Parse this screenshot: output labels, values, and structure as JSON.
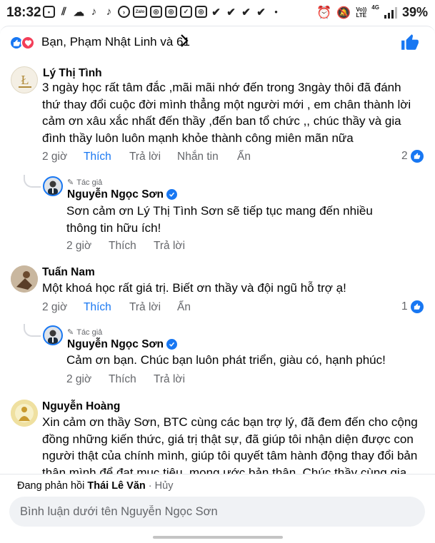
{
  "status_bar": {
    "time": "18:32",
    "left_icons": [
      "gallery-icon",
      "signal-bars-icon",
      "cloud-icon",
      "tiktok-icon",
      "tiktok-icon",
      "play-icon",
      "zalo-icon",
      "instagram-icon",
      "instagram-icon",
      "check-icon",
      "instagram-icon",
      "check-icon",
      "check-icon",
      "check-icon",
      "check-icon",
      "dot-icon"
    ],
    "zalo_label": "Zalo",
    "net_top": "Vo))",
    "net_bottom": "LTE",
    "net_gen": "4G",
    "battery": "39%"
  },
  "reactions": {
    "text": "Bạn, Phạm Nhật Linh và 61"
  },
  "comments": [
    {
      "author": "Lý Thị Tình",
      "text": "3 ngày  học rất tâm đắc  ,mãi mãi nhớ đến  trong 3ngày thôi đã đánh thứ thay đổi cuộc đời mình thẳng một người mới ,   em chân thành lời cảm ơn xâu xắc nhất đến thầy ,đến ban tổ chức ,, chúc thầy và gia đình thầy luôn luôn mạnh khỏe  thành công miên mãn  nữa",
      "time": "2 giờ",
      "like": "Thích",
      "reply": "Trả lời",
      "message": "Nhắn tin",
      "hide": "Ẩn",
      "reaction_count": "2"
    },
    {
      "author": "Tuấn Nam",
      "text": "Một khoá học rất giá trị. Biết ơn thầy và đội ngũ hỗ trợ ạ!",
      "time": "2 giờ",
      "like": "Thích",
      "reply": "Trả lời",
      "hide": "Ẩn",
      "reaction_count": "1"
    },
    {
      "author": "Nguyễn Hoàng",
      "text": "Xin cảm ơn thầy Sơn, BTC cùng các bạn trợ lý, đã đem đến cho cộng đồng những kiến thức, giá trị thật sự, đã giúp tôi nhận diện được con người thật của chính mình, giúp tôi quyết tâm hành động thay đổi bản thân mình để đạt mục tiêu, mong ước bản thân. Chúc thầy cùng gia"
    }
  ],
  "replies": [
    {
      "badge": "Tác giả",
      "author": "Nguyễn Ngọc Sơn",
      "text": "Sơn cảm ơn Lý Thị Tình Sơn sẽ tiếp tục mang đến nhiều thông tin hữu ích!",
      "time": "2 giờ",
      "like": "Thích",
      "reply": "Trả lời"
    },
    {
      "badge": "Tác giả",
      "author": "Nguyễn Ngọc Sơn",
      "text": "Cảm ơn bạn. Chúc bạn luôn phát triển, giàu có, hạnh phúc!",
      "time": "2 giờ",
      "like": "Thích",
      "reply": "Trả lời"
    }
  ],
  "composer": {
    "replying_prefix": "Đang phản hồi",
    "replying_to": "Thái Lê Văn",
    "separator": "·",
    "cancel": "Hủy",
    "placeholder": "Bình luận dưới tên Nguyễn Ngọc Sơn"
  },
  "colors": {
    "accent": "#1877f2",
    "love": "#f33e58",
    "muted_text": "#65676b",
    "input_bg": "#f0f2f5"
  }
}
